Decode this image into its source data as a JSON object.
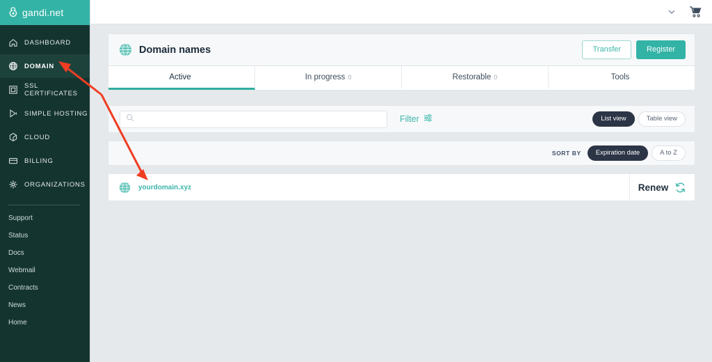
{
  "brand": {
    "logo_text": "gandi.net",
    "logo_icon": "gandi-mark-icon",
    "header_color": "#33b3a6",
    "sidebar_color": "#143430"
  },
  "topbar": {
    "chevron_icon": "chevron-down-icon",
    "cart_icon": "shopping-cart-icon"
  },
  "sidebar": {
    "items": [
      {
        "label": "DASHBOARD",
        "icon": "home-icon",
        "active": false
      },
      {
        "label": "DOMAIN",
        "icon": "globe-icon",
        "active": true
      },
      {
        "label": "SSL CERTIFICATES",
        "icon": "certificate-icon",
        "active": false
      },
      {
        "label": "SIMPLE HOSTING",
        "icon": "play-icon",
        "active": false
      },
      {
        "label": "CLOUD",
        "icon": "cloud-hex-icon",
        "active": false
      },
      {
        "label": "BILLING",
        "icon": "credit-card-icon",
        "active": false
      },
      {
        "label": "ORGANIZATIONS",
        "icon": "organizations-icon",
        "active": false
      }
    ],
    "links": [
      {
        "label": "Support"
      },
      {
        "label": "Status"
      },
      {
        "label": "Docs"
      },
      {
        "label": "Webmail"
      },
      {
        "label": "Contracts"
      },
      {
        "label": "News"
      },
      {
        "label": "Home"
      }
    ]
  },
  "panel": {
    "title": "Domain names",
    "title_icon": "globe-icon",
    "transfer_label": "Transfer",
    "register_label": "Register",
    "accent_color": "#33b3a6"
  },
  "tabs": [
    {
      "label": "Active",
      "count": "",
      "active": true
    },
    {
      "label": "In progress",
      "count": "0",
      "active": false
    },
    {
      "label": "Restorable",
      "count": "0",
      "active": false
    },
    {
      "label": "Tools",
      "count": "",
      "active": false
    }
  ],
  "toolbar": {
    "search_value": "",
    "search_placeholder": "",
    "search_icon": "search-icon",
    "filter_label": "Filter",
    "filter_icon": "sliders-icon",
    "views": [
      {
        "label": "List view",
        "active": true
      },
      {
        "label": "Table view",
        "active": false
      }
    ]
  },
  "sort": {
    "label": "SORT BY",
    "options": [
      {
        "label": "Expiration date",
        "active": true
      },
      {
        "label": "A to Z",
        "active": false
      }
    ]
  },
  "domains": [
    {
      "name": "yourdomain.xyz",
      "icon": "globe-icon",
      "action_label": "Renew",
      "action_icon": "refresh-icon"
    }
  ],
  "annotations": {
    "arrow_color": "#ef3e23",
    "arrows": [
      {
        "name": "arrow-to-domain-nav",
        "target": "DOMAIN"
      },
      {
        "name": "arrow-to-domain-name",
        "target": "yourdomain.xyz"
      }
    ]
  }
}
